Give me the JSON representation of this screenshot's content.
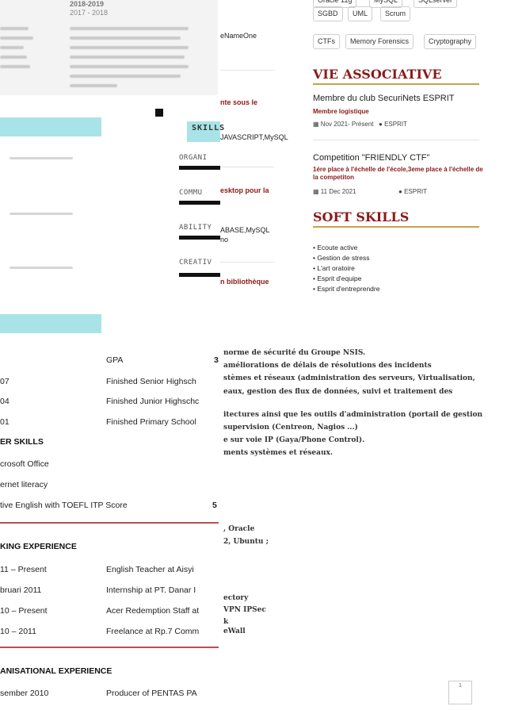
{
  "blur_fragment": {
    "year_label": "2018-2019",
    "sub_label": "2017 - 2018"
  },
  "skills_fragment": {
    "title": "SKILLS",
    "items": [
      "ORGANI",
      "COMMU",
      "ABILITY",
      "CREATIV"
    ]
  },
  "middle_strip": {
    "lines": [
      {
        "text": "eNameOne",
        "style": "normal"
      },
      {
        "text": "nte sous le",
        "style": "red"
      },
      {
        "text": "JAVASCRIPT,MySQL",
        "style": "normal"
      },
      {
        "text": "esktop pour la",
        "style": "red"
      },
      {
        "text": "ABASE,MySQL",
        "style": "normal"
      },
      {
        "text": "no",
        "style": "normal"
      },
      {
        "text": "n bibliothèque",
        "style": "red"
      }
    ]
  },
  "right_column": {
    "tags_row1": [
      "Oracle 11g",
      "MySQL",
      "SQLserver"
    ],
    "tags_row2": [
      "SGBD",
      "UML",
      "Scrum"
    ],
    "tags_row3": [
      "CTFs",
      "Memory Forensics",
      "Cryptography"
    ],
    "vie_associative": {
      "title": "VIE ASSOCIATIVE",
      "entries": [
        {
          "title": "Membre du club SecuriNets ESPRIT",
          "role": "Membre logistique",
          "date": "Nov 2021- Présent",
          "place": "ESPRIT"
        },
        {
          "title": "Competition \"FRIENDLY CTF\"",
          "role": "1ére place à l'échelle de l'école,3eme place à l'échelle de la competiton",
          "date": "11 Dec 2021",
          "place": "ESPRIT"
        }
      ]
    },
    "soft_skills": {
      "title": "SOFT SKILLS",
      "items": [
        "Ecoute active",
        "Gestion de stress",
        "L'art oratoire",
        "Esprit d'equipe",
        "Esprit d'entreprendre"
      ]
    }
  },
  "lower_left": {
    "gpa_label": "GPA",
    "gpa_value": "3",
    "education": [
      {
        "year": "07",
        "text": "Finished Senior Highsch"
      },
      {
        "year": "04",
        "text": "Finished Junior Highschc"
      },
      {
        "year": "01",
        "text": "Finished Primary School"
      }
    ],
    "other_skills_title": "ER SKILLS",
    "other_skills": [
      "crosoft Office",
      "ernet literacy",
      "tive English with TOEFL ITP Score"
    ],
    "toefl_value": "5",
    "working_title": "KING EXPERIENCE",
    "working": [
      {
        "period": "11 – Present",
        "text": "English Teacher at  Aisyi"
      },
      {
        "period": "bruari 2011",
        "text": "Internship at PT. Danar I"
      },
      {
        "period": "10 – Present",
        "text": "Acer Redemption Staff at"
      },
      {
        "period": "10 – 2011",
        "text": "Freelance at Rp.7 Comm"
      }
    ],
    "org_title": "ANISATIONAL EXPERIENCE",
    "org": [
      {
        "period": "sember  2010",
        "text": "Producer of PENTAS PA"
      }
    ]
  },
  "serif_fragment": {
    "lines": [
      "norme de sécurité du Groupe NSIS.",
      "améliorations de délais de résolutions des incidents",
      "stèmes et réseaux (administration des serveurs, Virtualisation,",
      "eaux, gestion des flux de données, suivi et traitement des",
      "itectures ainsi que les outils d'administration (portail de gestion",
      "supervision (Centreon, Nagios ...)",
      "e sur voie IP (Gaya/Phone Control).",
      "ments systèmes et réseaux."
    ],
    "lower_lines": [
      ", Oracle",
      "2, Ubuntu ;",
      "ectory",
      "VPN IPSec",
      "k",
      "eWall"
    ]
  },
  "page_number": "1"
}
